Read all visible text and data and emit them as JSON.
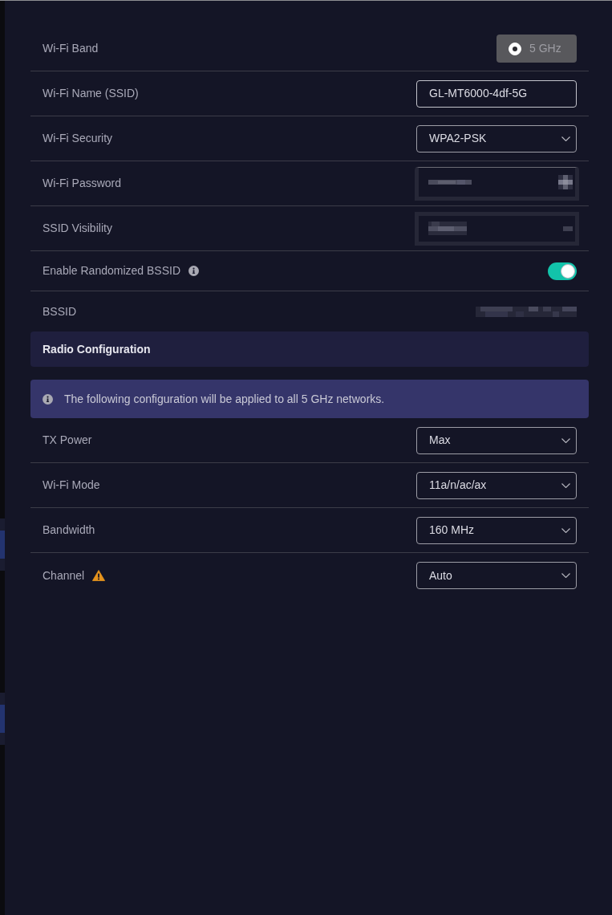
{
  "settings": [
    {
      "kind": "band",
      "label": "Wi-Fi Band",
      "value": "5 GHz",
      "selected": true,
      "disabled": true
    },
    {
      "kind": "input",
      "label": "Wi-Fi Name (SSID)",
      "value": "GL-MT6000-4df-5G"
    },
    {
      "kind": "select",
      "label": "Wi-Fi Security",
      "value": "WPA2-PSK"
    },
    {
      "kind": "redacted_input",
      "label": "Wi-Fi Password"
    },
    {
      "kind": "redacted_select",
      "label": "SSID Visibility"
    },
    {
      "kind": "toggle",
      "label": "Enable Randomized BSSID",
      "info": true,
      "on": true
    },
    {
      "kind": "redacted_value",
      "label": "BSSID"
    }
  ],
  "section": {
    "title": "Radio Configuration"
  },
  "notice": {
    "text": "The following configuration will be applied to all 5 GHz networks."
  },
  "radio_settings": [
    {
      "kind": "select",
      "label": "TX Power",
      "value": "Max"
    },
    {
      "kind": "select",
      "label": "Wi-Fi Mode",
      "value": "11a/n/ac/ax"
    },
    {
      "kind": "select",
      "label": "Bandwidth",
      "value": "160 MHz"
    },
    {
      "kind": "select",
      "label": "Channel",
      "warning": true,
      "value": "Auto"
    }
  ]
}
